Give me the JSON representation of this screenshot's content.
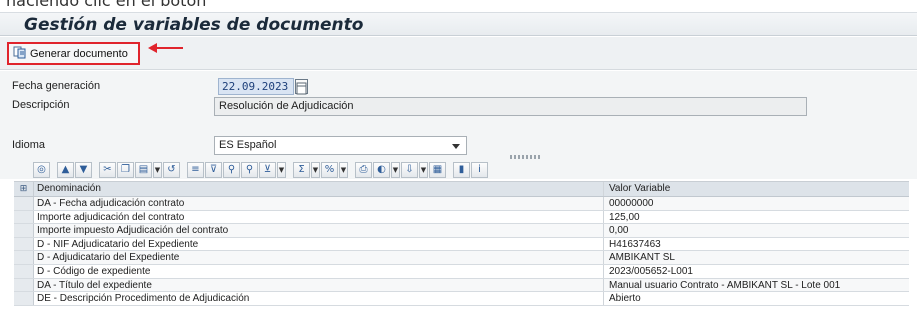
{
  "top_fragment": "haciendo clic en el botón",
  "window": {
    "title": "Gestión de variables de documento"
  },
  "toolbar": {
    "generate_button": {
      "label": "Generar documento",
      "icon": "document-generate-icon"
    },
    "annotation": {
      "arrow_color": "#e0242c"
    }
  },
  "form": {
    "fecha_label": "Fecha generación",
    "fecha_value": "22.09.2023",
    "descripcion_label": "Descripción",
    "descripcion_value": "Resolución de Adjudicación",
    "idioma_label": "Idioma",
    "idioma_value": "ES Español"
  },
  "alv_toolbar_icons": [
    "details-icon",
    "sort-ascending-icon",
    "sort-descending-icon",
    "cut-icon",
    "copy-icon",
    "paste-icon",
    "undo-icon",
    "align-icon",
    "filter-icon",
    "find-icon",
    "find-next-icon",
    "set-filter-icon",
    "sum-icon",
    "subtotal-icon",
    "print-icon",
    "views-icon",
    "export-icon",
    "layout-icon",
    "graphic-icon",
    "info-icon"
  ],
  "grid": {
    "columns": {
      "denominacion": "Denominación",
      "valor": "Valor Variable"
    },
    "rows": [
      {
        "denominacion": "DA - Fecha adjudicación contrato",
        "valor": "00000000"
      },
      {
        "denominacion": "Importe adjudicación del contrato",
        "valor": "125,00"
      },
      {
        "denominacion": "Importe impuesto Adjudicación del contrato",
        "valor": "0,00"
      },
      {
        "denominacion": "D - NIF Adjudicatario del Expediente",
        "valor": "H41637463"
      },
      {
        "denominacion": "D - Adjudicatario del Expediente",
        "valor": "AMBIKANT SL"
      },
      {
        "denominacion": "D - Código de expediente",
        "valor": "2023/005652-L001"
      },
      {
        "denominacion": "DA - Título del expediente",
        "valor": "Manual usuario Contrato - AMBIKANT SL - Lote 001"
      },
      {
        "denominacion": "DE - Descripción Procedimento de Adjudicación",
        "valor": "Abierto"
      }
    ]
  }
}
